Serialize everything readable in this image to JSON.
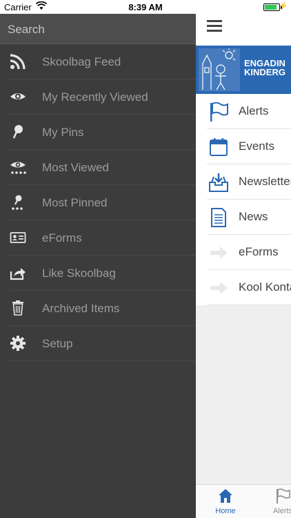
{
  "status": {
    "carrier": "Carrier",
    "time": "8:39 AM",
    "battery_level": 0.85
  },
  "search": {
    "placeholder": "Search"
  },
  "drawer": {
    "items": [
      {
        "label": "Skoolbag Feed",
        "icon": "rss-icon"
      },
      {
        "label": "My Recently Viewed",
        "icon": "eye-icon"
      },
      {
        "label": "My Pins",
        "icon": "pin-icon"
      },
      {
        "label": "Most Viewed",
        "icon": "eye-dots-icon"
      },
      {
        "label": "Most Pinned",
        "icon": "pin-dots-icon"
      },
      {
        "label": "eForms",
        "icon": "id-card-icon"
      },
      {
        "label": "Like Skoolbag",
        "icon": "share-icon"
      },
      {
        "label": "Archived Items",
        "icon": "trash-icon"
      },
      {
        "label": "Setup",
        "icon": "gear-icon"
      }
    ]
  },
  "banner": {
    "line1": "ENGADIN",
    "line2": "KINDERG"
  },
  "list": {
    "items": [
      {
        "label": "Alerts",
        "icon": "flag-icon"
      },
      {
        "label": "Events",
        "icon": "calendar-icon"
      },
      {
        "label": "Newsletters",
        "icon": "inbox-icon"
      },
      {
        "label": "News",
        "icon": "document-icon"
      },
      {
        "label": "eForms",
        "icon": "arrow-right-icon"
      },
      {
        "label": "Kool Kontacts",
        "icon": "arrow-right-icon"
      }
    ]
  },
  "tabs": [
    {
      "label": "Home",
      "icon": "home-icon"
    },
    {
      "label": "Alerts",
      "icon": "flag-icon"
    }
  ],
  "colors": {
    "drawer_bg": "#3c3c3c",
    "accent": "#2a68b4",
    "banner": "#2a68b4"
  }
}
